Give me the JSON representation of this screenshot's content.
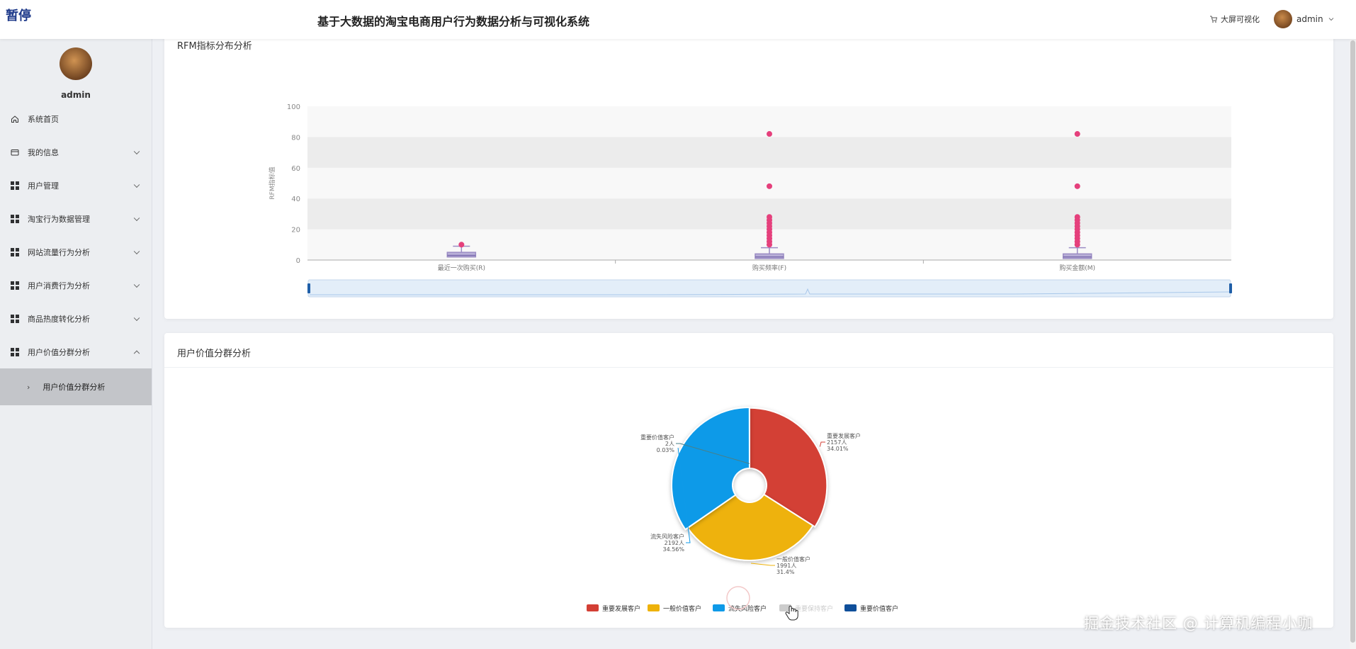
{
  "header": {
    "paused_badge": "暂停",
    "title": "基于大数据的淘宝电商用户行为数据分析与可视化系统",
    "bigscreen_label": "大屏可视化",
    "user": "admin"
  },
  "sidebar": {
    "username": "admin",
    "items": [
      {
        "label": "系统首页",
        "icon": "home-icon"
      },
      {
        "label": "我的信息",
        "icon": "card-icon"
      },
      {
        "label": "用户管理",
        "icon": "grid-icon"
      },
      {
        "label": "淘宝行为数据管理",
        "icon": "grid-icon"
      },
      {
        "label": "网站流量行为分析",
        "icon": "grid-icon"
      },
      {
        "label": "用户消费行为分析",
        "icon": "grid-icon"
      },
      {
        "label": "商品热度转化分析",
        "icon": "grid-icon"
      },
      {
        "label": "用户价值分群分析",
        "icon": "grid-icon"
      }
    ],
    "active_sub": "用户价值分群分析"
  },
  "card1": {
    "title": "RFM指标分布分析"
  },
  "card2": {
    "title": "用户价值分群分析"
  },
  "chart_data": [
    {
      "type": "boxplot",
      "ylabel": "RFM指标值",
      "ylim": [
        0,
        100
      ],
      "yticks": [
        0,
        20,
        40,
        60,
        80,
        100
      ],
      "categories": [
        "最近一次购买(R)",
        "购买频率(F)",
        "购买金额(M)"
      ],
      "boxes": [
        {
          "min": 1,
          "q1": 2,
          "median": 3,
          "q3": 5,
          "max": 9,
          "outliers": [
            10
          ]
        },
        {
          "min": 1,
          "q1": 1,
          "median": 2,
          "q3": 4,
          "max": 8,
          "outliers": [
            10,
            12,
            14,
            16,
            18,
            20,
            22,
            24,
            26,
            28,
            48,
            82
          ]
        },
        {
          "min": 1,
          "q1": 1,
          "median": 2,
          "q3": 4,
          "max": 8,
          "outliers": [
            10,
            12,
            14,
            16,
            18,
            20,
            22,
            24,
            26,
            28,
            48,
            82
          ]
        }
      ],
      "box_color": "#9b8cc4",
      "outlier_color": "#e5407c",
      "grid": true
    },
    {
      "type": "pie",
      "subtype": "rose",
      "series": [
        {
          "name": "重要发展客户",
          "count": "2157人",
          "percent": "34.01%",
          "value": 2157,
          "color": "#d33f35"
        },
        {
          "name": "一般价值客户",
          "count": "1991人",
          "percent": "31.4%",
          "value": 1991,
          "color": "#eeb20a"
        },
        {
          "name": "流失风险客户",
          "count": "2192人",
          "percent": "34.56%",
          "value": 2192,
          "color": "#0f9ae8"
        },
        {
          "name": "重要保持客户",
          "count": "",
          "percent": "",
          "value": 0,
          "color": "#cccccc",
          "disabled": true
        },
        {
          "name": "重要价值客户",
          "count": "2人",
          "percent": "0.03%",
          "value": 2,
          "color": "#0f4f9a"
        }
      ],
      "legend": "bottom-center"
    }
  ],
  "watermark": "掘金技术社区 @ 计算机编程小咖"
}
